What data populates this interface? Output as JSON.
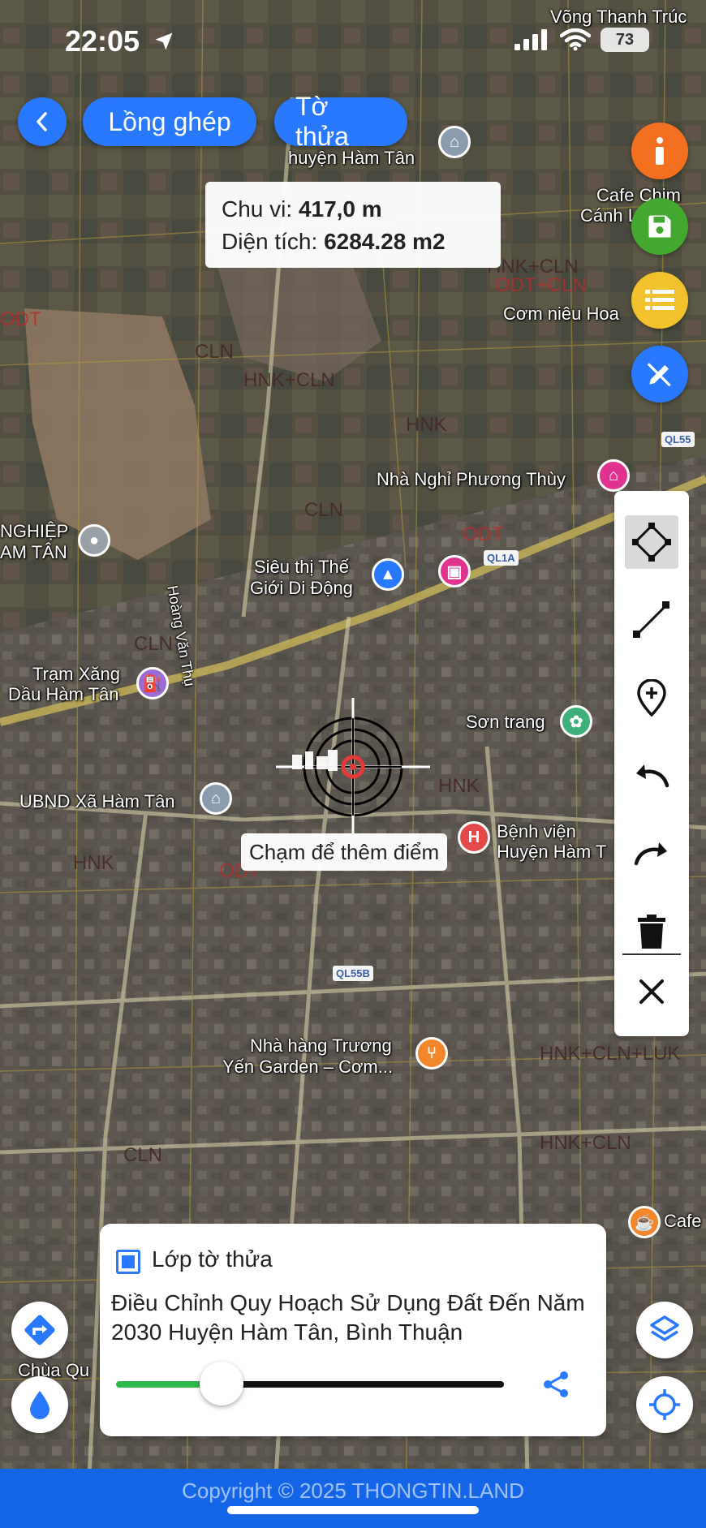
{
  "status_bar": {
    "time": "22:05",
    "battery": "73"
  },
  "top_bar": {
    "back_icon": "chevron-left-icon",
    "overlay_button": "Lồng ghép",
    "parcel_button": "Tờ thửa"
  },
  "measurement": {
    "perimeter_label": "Chu vi:",
    "perimeter_value": "417,0 m",
    "area_label": "Diện tích:",
    "area_value": "6284.28 m2"
  },
  "right_fabs": [
    {
      "icon": "info-icon",
      "color": "#f37021"
    },
    {
      "icon": "save-icon",
      "color": "#43a82f"
    },
    {
      "icon": "list-icon",
      "color": "#f2c12e"
    },
    {
      "icon": "edit-draw-icon",
      "color": "#2979ff"
    }
  ],
  "tools": [
    {
      "icon": "polygon-icon",
      "active": true
    },
    {
      "icon": "line-icon",
      "active": false
    },
    {
      "icon": "add-point-icon",
      "active": false
    },
    {
      "icon": "undo-icon",
      "active": false
    },
    {
      "icon": "redo-icon",
      "active": false
    },
    {
      "icon": "trash-icon",
      "active": false
    },
    {
      "icon": "close-icon",
      "active": false
    }
  ],
  "crosshair": {
    "marker_text": "3.5m"
  },
  "tap_hint": "Chạm để thêm điểm",
  "layer_card": {
    "checked": true,
    "title": "Lớp tờ thửa",
    "description": "Điều Chỉnh Quy Hoạch Sử Dụng Đất Đến Năm 2030 Huyện Hàm Tân, Bình Thuận",
    "opacity": 0.24
  },
  "map_labels": {
    "vong_thanh_truc": "Võng Thanh Trúc",
    "huyen_ham_tan": "huyện Hàm Tân",
    "cafe_chim": "Cafe Chim",
    "canh_lam": "Cánh Lâm",
    "com_nieu_hoa": "Cơm niêu Hoa",
    "nha_nghi": "Nhà Nghỉ Phương Thùy",
    "ql55": "QL55",
    "nghiep": "NGHIỆP",
    "am_tan": "AM TÂN",
    "sieu_thi_1": "Siêu thị Thế",
    "sieu_thi_2": "Giới Di Động",
    "ql1a": "QL1A",
    "hoang_van_thu": "Hoàng Văn Thụ",
    "tram_xang_1": "Trạm Xăng",
    "tram_xang_2": "Dầu Hàm Tân",
    "son_trang": "Sơn trang",
    "ubnd": "UBND Xã Hàm Tân",
    "benh_vien_1": "Bệnh viện",
    "benh_vien_2": "Huyện Hàm T",
    "ql55b": "QL55B",
    "nha_hang_1": "Nhà hàng Trương",
    "nha_hang_2": "Yến Garden – Cơm...",
    "cafe": "Cafe",
    "chua": "Chùa Qu"
  },
  "zone_labels": [
    "HNK+CLN",
    "ODT+CLN",
    "CLN",
    "ODT",
    "HNK",
    "CLN",
    "HNK+CLN",
    "ODT",
    "CLN",
    "HNK",
    "ODT",
    "HNK+CLN+LUK",
    "HNK+CLN",
    "CLN",
    "HNK"
  ],
  "bottom_buttons": {
    "directions_icon": "directions-icon",
    "water_icon": "water-drop-icon",
    "layers_icon": "layers-icon",
    "locate_icon": "locate-icon",
    "share_icon": "share-icon"
  },
  "footer": "Copyright © 2025 THONGTIN.LAND"
}
